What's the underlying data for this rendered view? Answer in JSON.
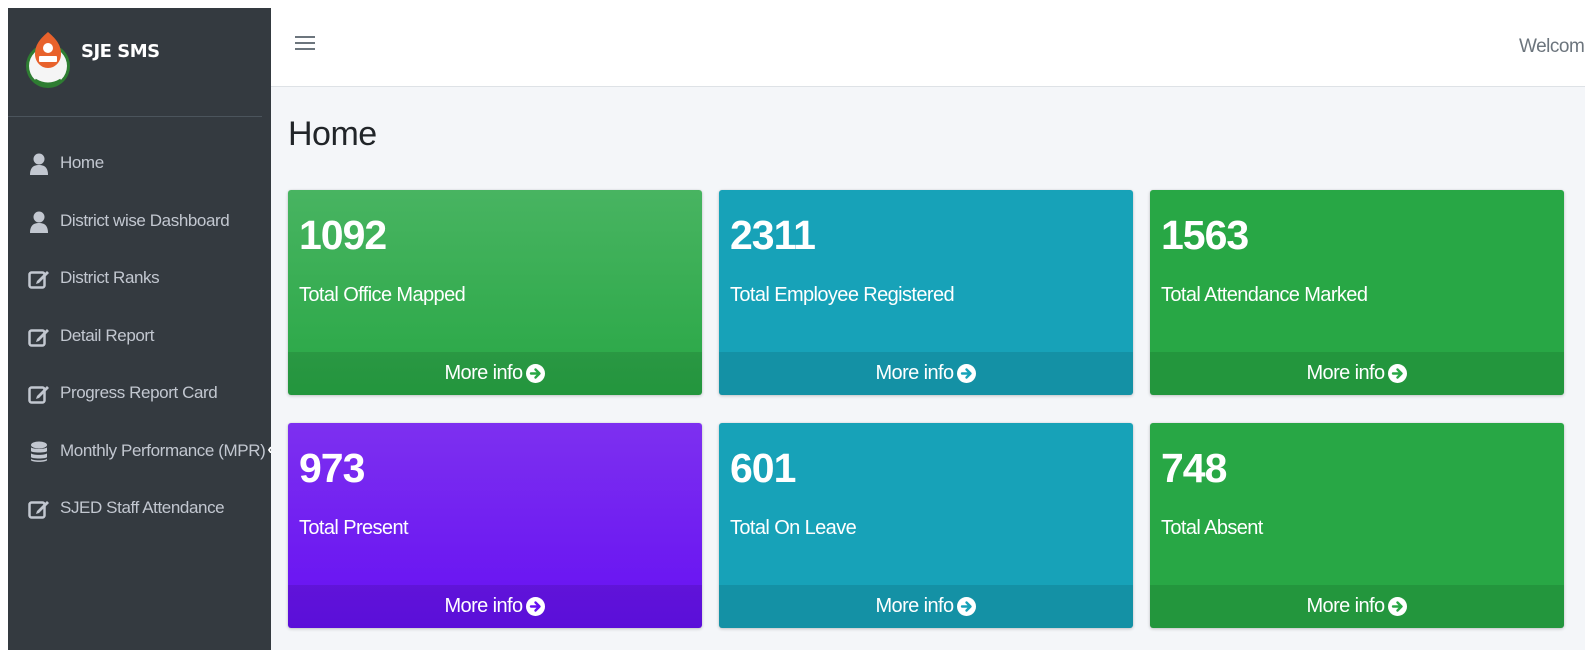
{
  "brand": {
    "name": "SJE SMS"
  },
  "sidebar": {
    "items": [
      {
        "label": "Home",
        "icon": "user-icon"
      },
      {
        "label": "District wise Dashboard",
        "icon": "user-icon"
      },
      {
        "label": "District Ranks",
        "icon": "edit-icon"
      },
      {
        "label": "Detail Report",
        "icon": "edit-icon"
      },
      {
        "label": "Progress Report Card",
        "icon": "edit-icon"
      },
      {
        "label": "Monthly Performance (MPR)",
        "icon": "database-icon",
        "chevron": "‹"
      },
      {
        "label": "SJED Staff Attendance",
        "icon": "edit-icon"
      }
    ]
  },
  "topbar": {
    "welcome": "Welcome"
  },
  "page": {
    "title": "Home"
  },
  "cards": [
    {
      "value": "1092",
      "label": "Total Office Mapped",
      "more": "More info",
      "color": "#28a745"
    },
    {
      "value": "2311",
      "label": "Total Employee Registered",
      "more": "More info",
      "color": "#17a2b8"
    },
    {
      "value": "1563",
      "label": "Total Attendance Marked",
      "more": "More info",
      "color": "#28a745"
    },
    {
      "value": "973",
      "label": "Total Present",
      "more": "More info",
      "color": "#6610f2"
    },
    {
      "value": "601",
      "label": "Total On Leave",
      "more": "More info",
      "color": "#17a2b8"
    },
    {
      "value": "748",
      "label": "Total Absent",
      "more": "More info",
      "color": "#28a745"
    }
  ]
}
